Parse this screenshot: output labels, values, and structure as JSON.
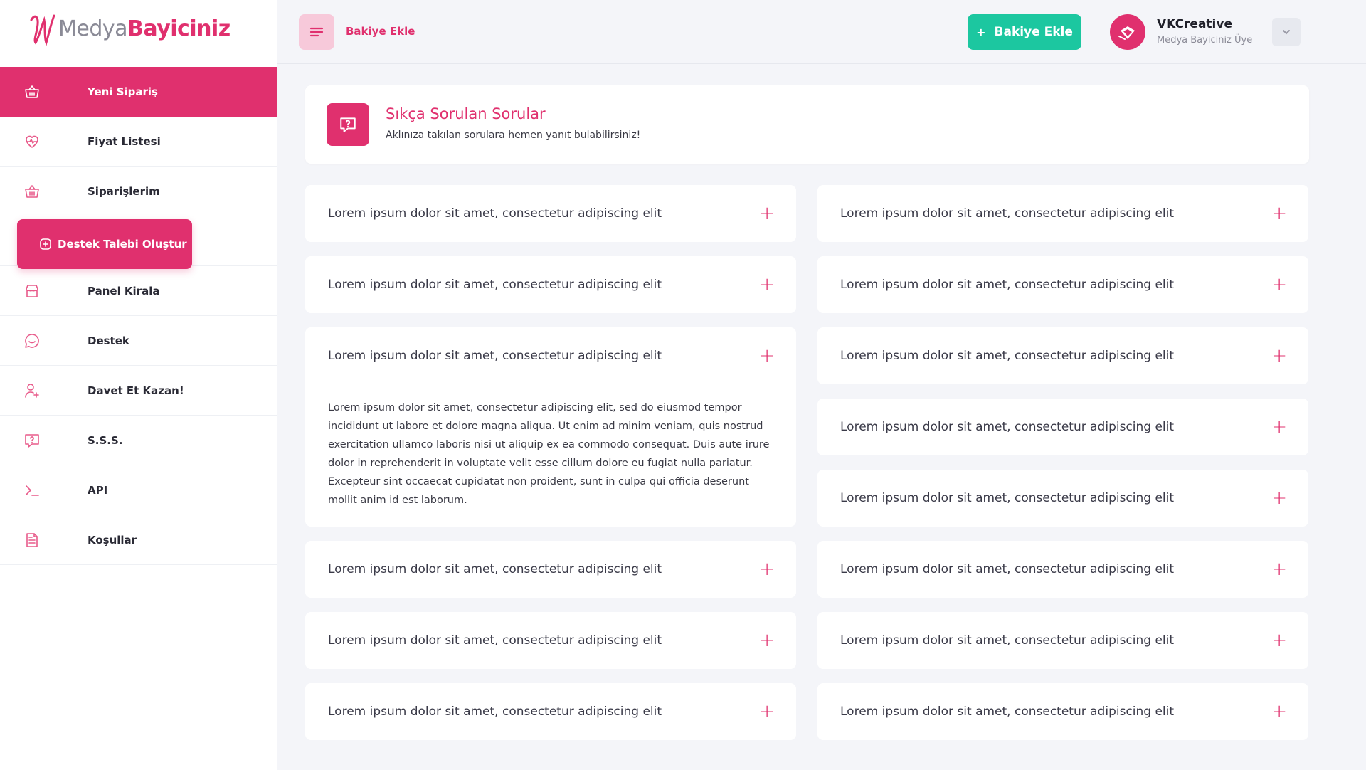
{
  "brand": {
    "part1": "Medya",
    "part2": "Bayiciniz"
  },
  "sidebar": {
    "items": [
      {
        "label": "Yeni Sipariş",
        "icon": "basket-icon",
        "active": true
      },
      {
        "label": "Fiyat Listesi",
        "icon": "heart-pulse-icon"
      },
      {
        "label": "Siparişlerim",
        "icon": "basket-outline-icon"
      },
      {
        "label": "Destek Talebi Oluştur",
        "icon": "plus-square-icon",
        "button": true
      },
      {
        "label": "Panel Kirala",
        "icon": "store-icon"
      },
      {
        "label": "Destek",
        "icon": "chat-bubble-icon"
      },
      {
        "label": "Davet Et Kazan!",
        "icon": "user-plus-icon"
      },
      {
        "label": "S.S.S.",
        "icon": "question-message-icon"
      },
      {
        "label": "API",
        "icon": "terminal-icon"
      },
      {
        "label": "Koşullar",
        "icon": "document-icon"
      }
    ]
  },
  "topbar": {
    "link_label": "Bakiye Ekle",
    "add_button_label": "Bakiye Ekle",
    "add_button_icon": "+",
    "user_name": "VKCreative",
    "user_role": "Medya Bayiciniz Üye"
  },
  "faq": {
    "title": "Sıkça Sorulan Sorular",
    "subtitle": "Aklınıza takılan sorulara hemen yanıt bulabilirsiniz!",
    "left": [
      {
        "q": "Lorem ipsum dolor sit amet, consectetur adipiscing elit"
      },
      {
        "q": "Lorem ipsum dolor sit amet, consectetur adipiscing elit"
      },
      {
        "q": "Lorem ipsum dolor sit amet, consectetur adipiscing elit",
        "a": "Lorem ipsum dolor sit amet, consectetur adipiscing elit, sed do eiusmod tempor incididunt ut labore et dolore magna aliqua. Ut enim ad minim veniam, quis nostrud exercitation ullamco laboris nisi ut aliquip ex ea commodo consequat. Duis aute irure dolor in reprehenderit in voluptate velit esse cillum dolore eu fugiat nulla pariatur. Excepteur sint occaecat cupidatat non proident, sunt in culpa qui officia deserunt mollit anim id est laborum."
      },
      {
        "q": "Lorem ipsum dolor sit amet, consectetur adipiscing elit"
      },
      {
        "q": "Lorem ipsum dolor sit amet, consectetur adipiscing elit"
      },
      {
        "q": "Lorem ipsum dolor sit amet, consectetur adipiscing elit"
      }
    ],
    "right": [
      {
        "q": "Lorem ipsum dolor sit amet, consectetur adipiscing elit"
      },
      {
        "q": "Lorem ipsum dolor sit amet, consectetur adipiscing elit"
      },
      {
        "q": "Lorem ipsum dolor sit amet, consectetur adipiscing elit"
      },
      {
        "q": "Lorem ipsum dolor sit amet, consectetur adipiscing elit"
      },
      {
        "q": "Lorem ipsum dolor sit amet, consectetur adipiscing elit"
      },
      {
        "q": "Lorem ipsum dolor sit amet, consectetur adipiscing elit"
      },
      {
        "q": "Lorem ipsum dolor sit amet, consectetur adipiscing elit"
      },
      {
        "q": "Lorem ipsum dolor sit amet, consectetur adipiscing elit"
      }
    ],
    "toggle_symbol": "+"
  },
  "colors": {
    "accent": "#e0306e",
    "success": "#1cc7a0",
    "background": "#f4f5f9"
  }
}
